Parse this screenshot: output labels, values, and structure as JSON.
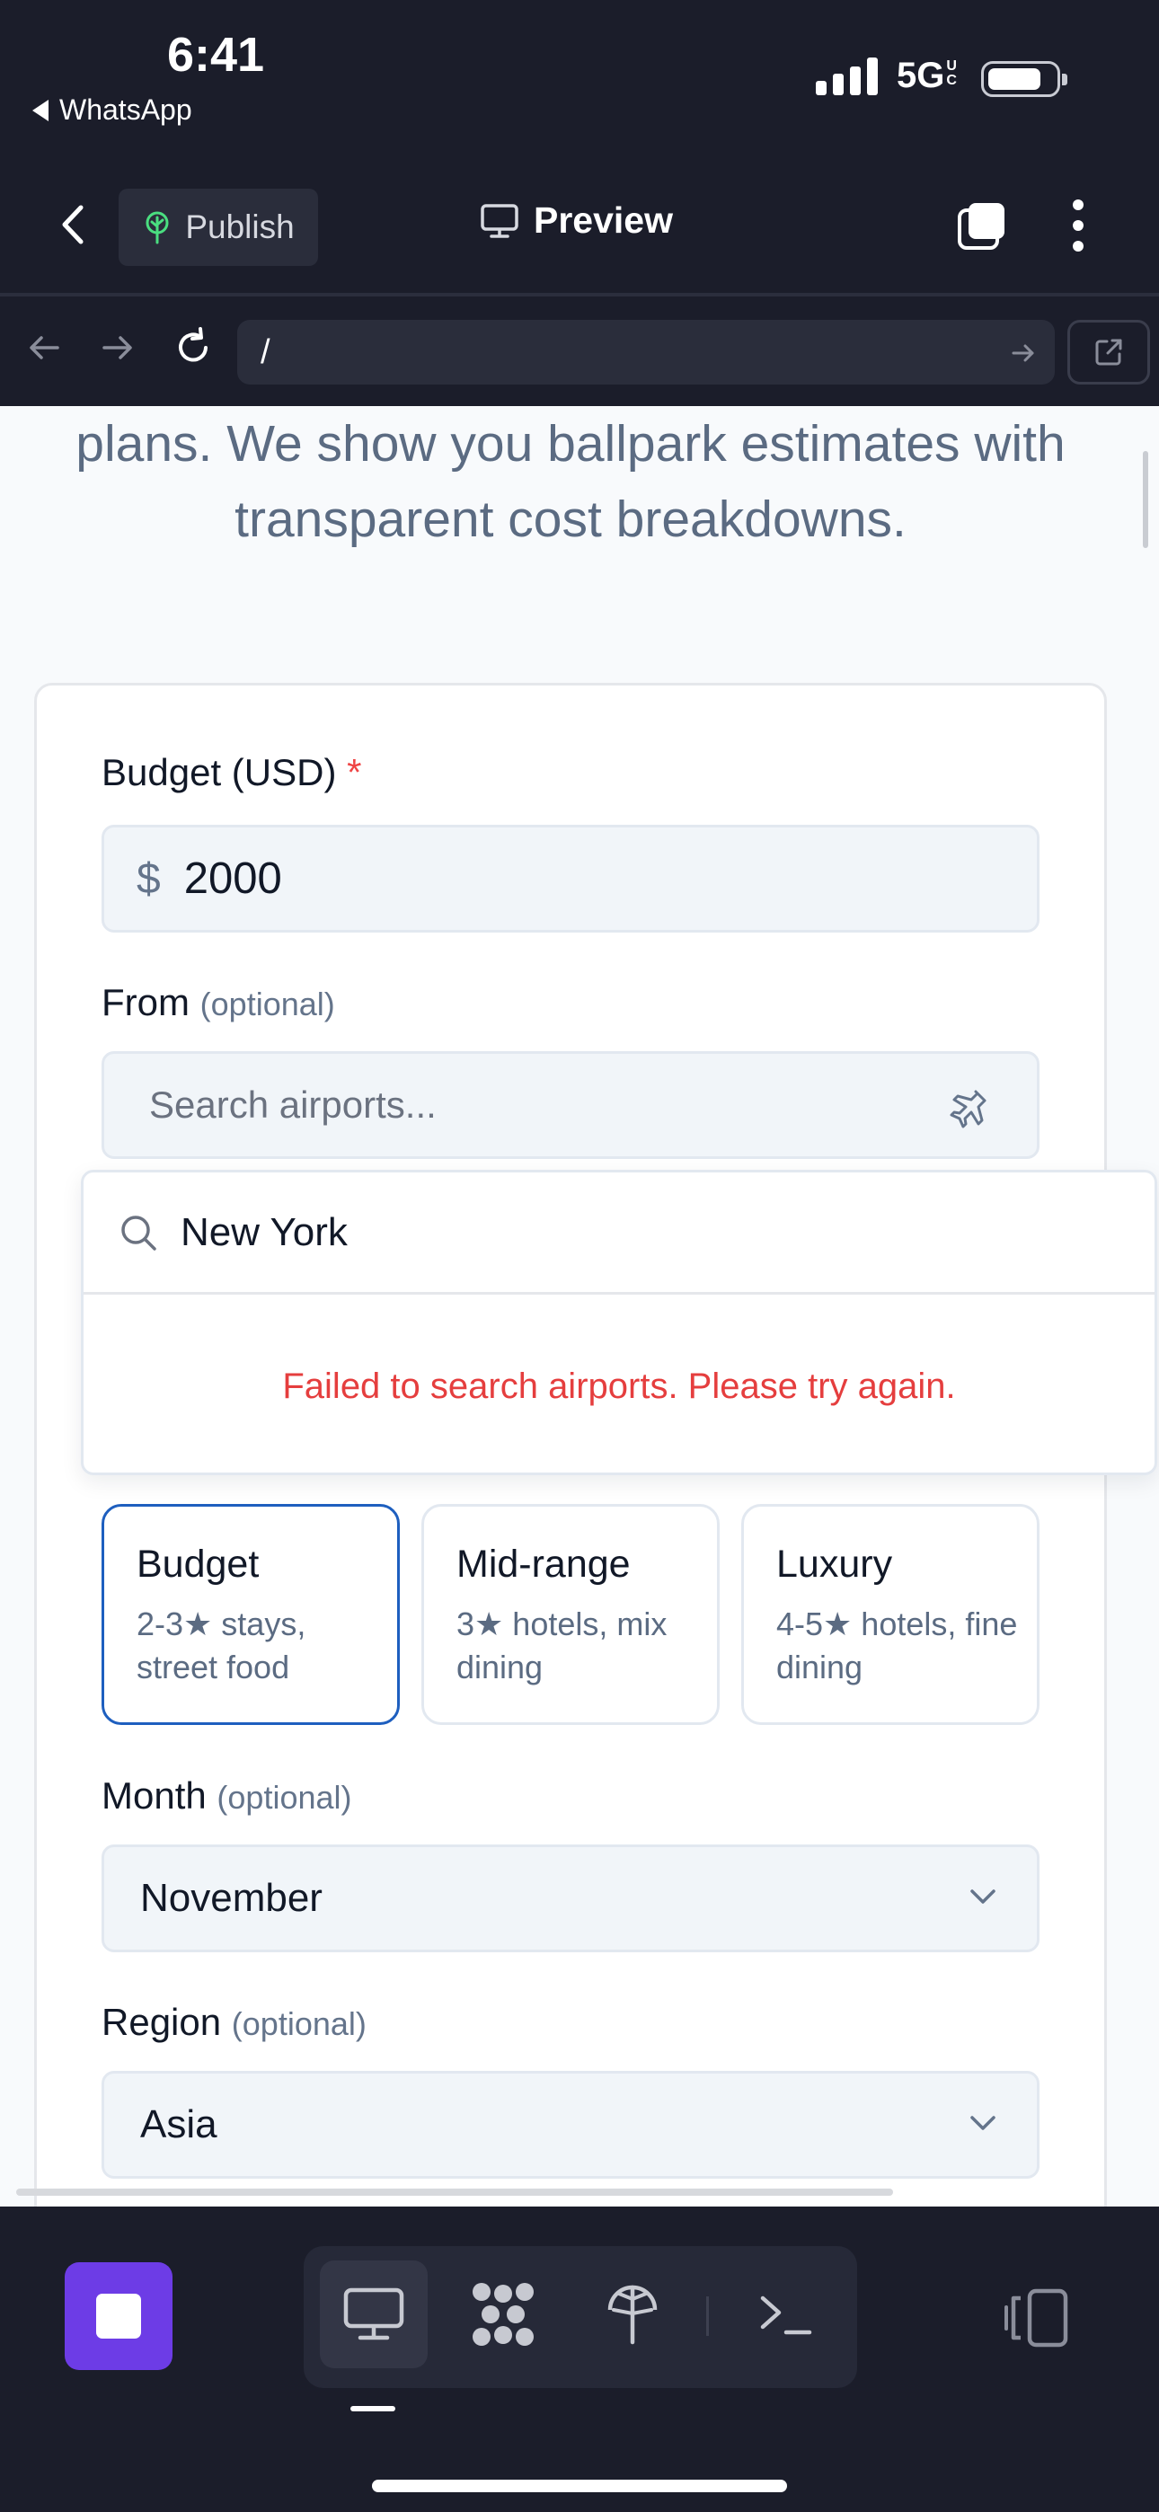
{
  "status_bar": {
    "time": "6:41",
    "back_app": "WhatsApp",
    "network": "5G",
    "network_suffix": "UC"
  },
  "toolbar": {
    "publish_label": "Publish",
    "preview_label": "Preview"
  },
  "browser": {
    "url": "/"
  },
  "page": {
    "intro_text": "plans. We show you ballpark estimates with transparent cost breakdowns.",
    "budget": {
      "label": "Budget (USD)",
      "required_mark": "*",
      "currency_symbol": "$",
      "value": "2000"
    },
    "from": {
      "label": "From",
      "optional": "(optional)",
      "placeholder": "Search airports..."
    },
    "airport_dropdown": {
      "query": "New York",
      "error": "Failed to search airports. Please try again."
    },
    "tiers": [
      {
        "title": "Budget",
        "desc": "2-3★ stays, street food",
        "selected": true
      },
      {
        "title": "Mid-range",
        "desc": "3★ hotels, mix dining",
        "selected": false
      },
      {
        "title": "Luxury",
        "desc": "4-5★ hotels, fine dining",
        "selected": false
      }
    ],
    "month": {
      "label": "Month",
      "optional": "(optional)",
      "value": "November"
    },
    "region": {
      "label": "Region",
      "optional": "(optional)",
      "value": "Asia"
    }
  },
  "colors": {
    "accent": "#6d3ce6",
    "selected_border": "#1e5fbf",
    "error": "#e53e3e",
    "chrome_bg": "#1b1d2a"
  }
}
